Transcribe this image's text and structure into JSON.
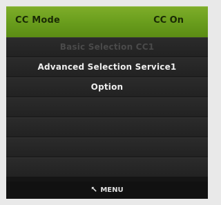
{
  "header": {
    "mode_label": "CC Mode",
    "mode_value": "CC On",
    "accent_color": "#6a9e1c"
  },
  "menu": {
    "items": [
      {
        "label": "Basic Selection CC1",
        "enabled": false
      },
      {
        "label": "Advanced Selection Service1",
        "enabled": true
      },
      {
        "label": "Option",
        "enabled": true
      },
      {
        "label": "",
        "enabled": false
      },
      {
        "label": "",
        "enabled": false
      },
      {
        "label": "",
        "enabled": false
      },
      {
        "label": "",
        "enabled": false
      }
    ]
  },
  "footer": {
    "icon": "back-arrow-icon",
    "label": "MENU"
  }
}
